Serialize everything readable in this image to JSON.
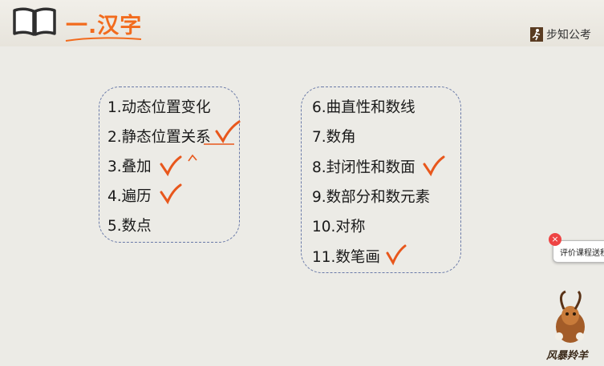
{
  "header": {
    "title": "一.汉字",
    "brand": "步知公考"
  },
  "left_list": [
    {
      "label": "1.动态位置变化",
      "checked": false
    },
    {
      "label": "2.静态位置关系",
      "checked": true
    },
    {
      "label": "3.叠加",
      "checked": true
    },
    {
      "label": "4.遍历",
      "checked": true
    },
    {
      "label": "5.数点",
      "checked": false
    }
  ],
  "right_list": [
    {
      "label": "6.曲直性和数线",
      "checked": false
    },
    {
      "label": "7.数角",
      "checked": false
    },
    {
      "label": "8.封闭性和数面",
      "checked": true
    },
    {
      "label": "9.数部分和数元素",
      "checked": false
    },
    {
      "label": "10.对称",
      "checked": false
    },
    {
      "label": "11.数笔画",
      "checked": true
    }
  ],
  "rating_popup": {
    "text": "评价课程送积分",
    "close_label": "×"
  },
  "watermark": {
    "text": "风暴羚羊"
  },
  "colors": {
    "accent": "#f26b1d",
    "check": "#e8571c",
    "box_border": "#6a7aa8"
  }
}
